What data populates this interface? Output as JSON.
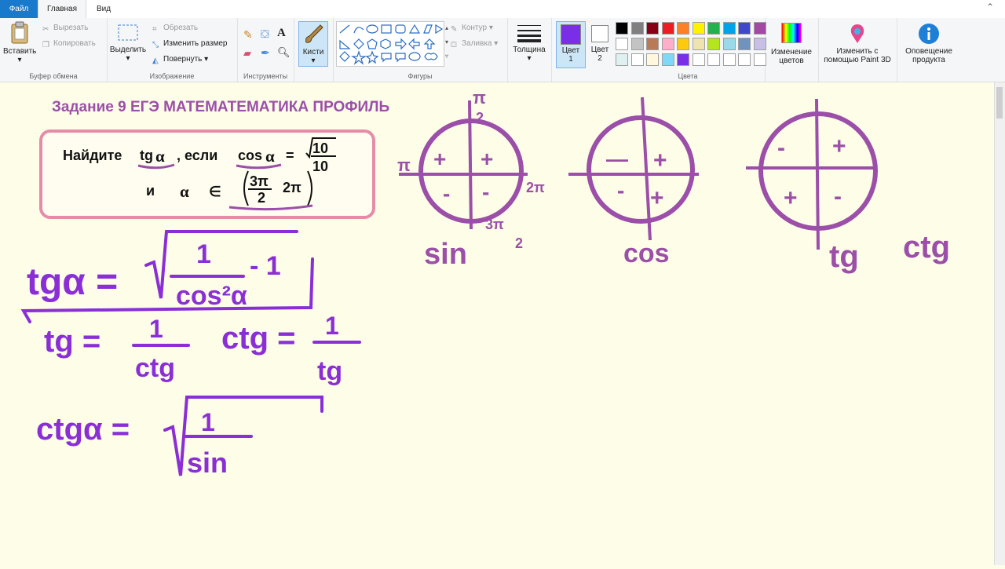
{
  "tabs": {
    "file": "Файл",
    "home": "Главная",
    "view": "Вид"
  },
  "ribbon": {
    "clipboard": {
      "paste": "Вставить",
      "cut": "Вырезать",
      "copy": "Копировать",
      "label": "Буфер обмена"
    },
    "image": {
      "select": "Выделить",
      "crop": "Обрезать",
      "resize": "Изменить размер",
      "rotate": "Повернуть",
      "label": "Изображение"
    },
    "tools": {
      "label": "Инструменты"
    },
    "brushes": {
      "label": "Кисти"
    },
    "shapes": {
      "outline": "Контур",
      "fill": "Заливка",
      "label": "Фигуры"
    },
    "size": {
      "label": "Толщина"
    },
    "color1": {
      "line1": "Цвет",
      "line2": "1"
    },
    "color2": {
      "line1": "Цвет",
      "line2": "2"
    },
    "colors": {
      "label": "Цвета",
      "palette": [
        "#000000",
        "#7f7f7f",
        "#880015",
        "#ed1c24",
        "#ff7f27",
        "#fff200",
        "#22b14c",
        "#00a2e8",
        "#3f48cc",
        "#a349a4",
        "#ffffff",
        "#c3c3c3",
        "#b97a57",
        "#ffaec9",
        "#ffc90e",
        "#efe4b0",
        "#b5e61d",
        "#99d9ea",
        "#7092be",
        "#c8bfe7",
        "#dff0f0",
        "#ffffff",
        "#fff8dc",
        "#80d8f8",
        "#7b2ee8",
        "#ffffff",
        "#ffffff",
        "#ffffff",
        "#ffffff",
        "#ffffff"
      ],
      "color1_value": "#7b2ee8",
      "color2_value": "#ffffff"
    },
    "edit_colors": {
      "line1": "Изменение",
      "line2": "цветов"
    },
    "paint3d": {
      "line1": "Изменить с",
      "line2": "помощью Paint 3D"
    },
    "notify": {
      "line1": "Оповещение",
      "line2": "продукта"
    }
  },
  "canvas": {
    "heading": "Задание 9  ЕГЭ МАТЕМАТЕМАТИКА ПРОФИЛЬ",
    "task": {
      "find": "Найдите",
      "tg": "tg",
      "alpha": "α",
      "if": ", если",
      "cos": "cos",
      "eq": "=",
      "num": "10",
      "den": "10",
      "and": "и",
      "in": "∈",
      "frac_num": "3π",
      "frac_den": "2",
      "two_pi": "2π"
    },
    "handwriting": {
      "formula1_lhs": "tgα =",
      "formula1_num": "1",
      "formula1_den": "cos²α",
      "formula1_minus": "- 1",
      "formula2_lhs": "tg =",
      "formula2_num": "1",
      "formula2_den": "ctg",
      "formula3_lhs": "ctg =",
      "formula3_num": "1",
      "formula3_den": "tg",
      "formula4_lhs": "ctgα =",
      "formula4_num": "1",
      "formula4_den": "sin"
    },
    "circles": {
      "sin": {
        "label": "sin",
        "top": "π",
        "top_den": "2",
        "left": "π",
        "right": "2π",
        "bottom": "3π",
        "bottom_den": "2",
        "q1": "+",
        "q2": "+",
        "q3": "-",
        "q4": "-"
      },
      "cos": {
        "label": "cos",
        "q1": "+",
        "q2": "—",
        "q3": "-",
        "q4": "+"
      },
      "tg": {
        "label": "tg",
        "label2": "ctg",
        "q1": "+",
        "q2": "-",
        "q3": "+",
        "q4": "-"
      }
    }
  }
}
